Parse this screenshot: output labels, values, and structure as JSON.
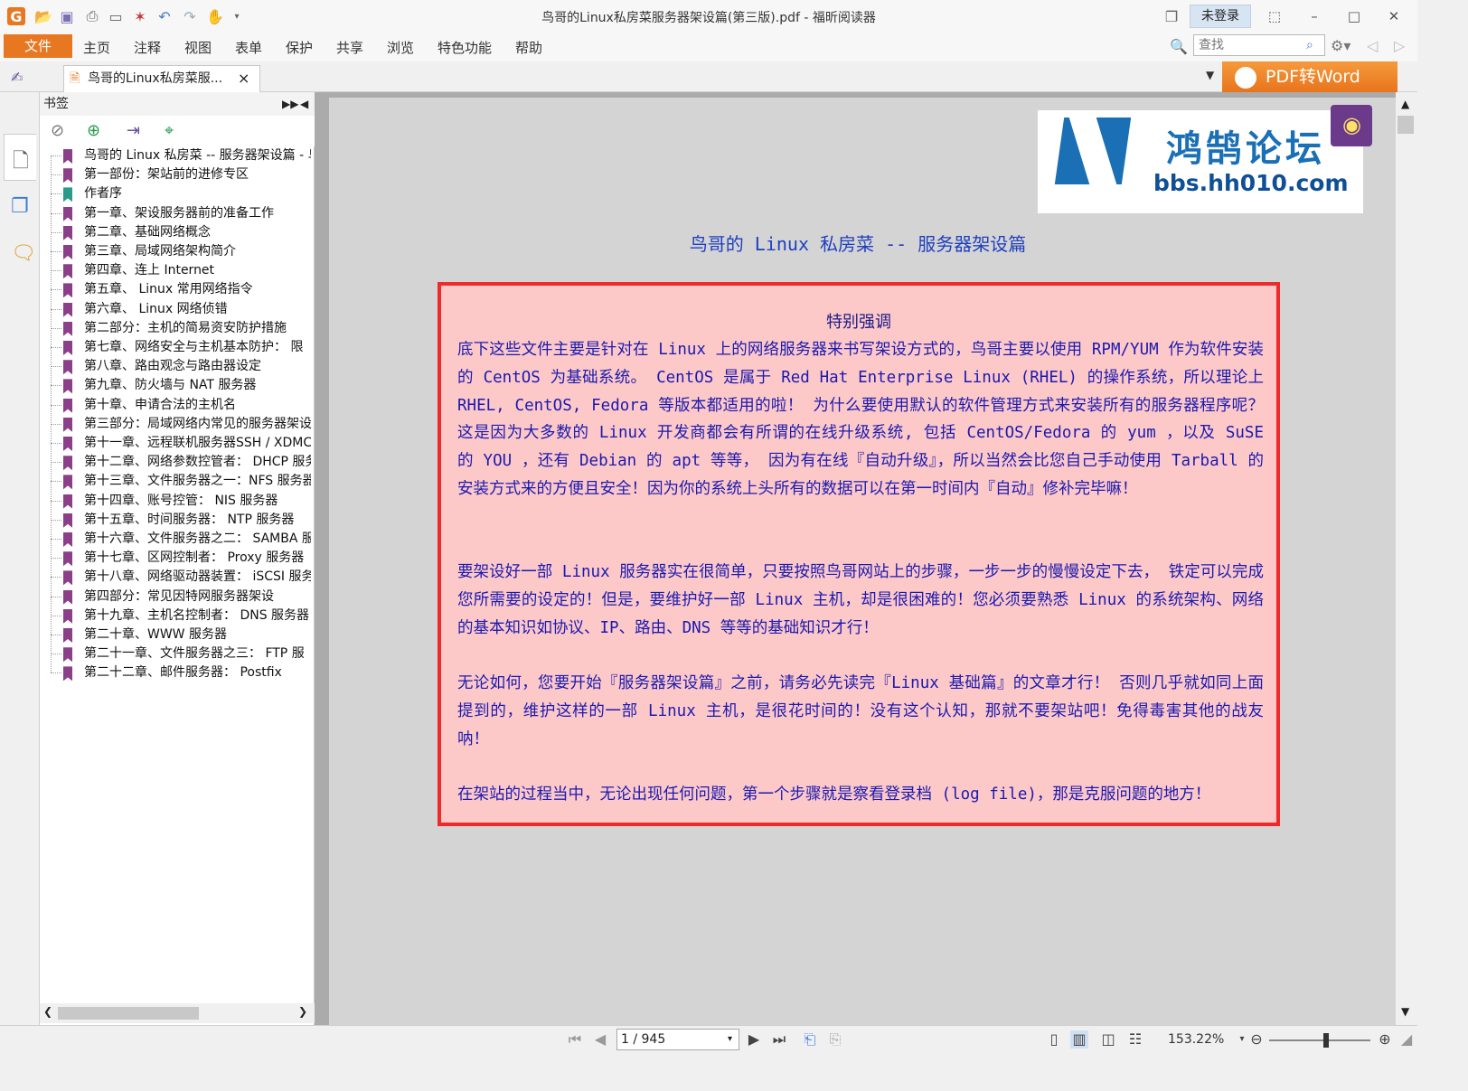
{
  "window": {
    "title": "鸟哥的Linux私房菜服务器架设篇(第三版).pdf - 福昕阅读器",
    "login_label": "未登录"
  },
  "menu": {
    "file": "文件",
    "items": [
      "主页",
      "注释",
      "视图",
      "表单",
      "保护",
      "共享",
      "浏览",
      "特色功能",
      "帮助"
    ],
    "search_placeholder": "查找"
  },
  "tab": {
    "label": "鸟哥的Linux私房菜服...",
    "close": "×",
    "promo": "PDF转Word"
  },
  "bookmarks": {
    "header": "书签",
    "items": [
      {
        "label": "鸟哥的 Linux 私房菜 -- 服务器架设篇 - 鸟",
        "color": "purple"
      },
      {
        "label": "第一部份：架站前的进修专区",
        "color": "purple"
      },
      {
        "label": "作者序",
        "color": "teal"
      },
      {
        "label": "第一章、架设服务器前的准备工作",
        "color": "purple"
      },
      {
        "label": "第二章、基础网络概念",
        "color": "purple"
      },
      {
        "label": "第三章、局域网络架构简介",
        "color": "purple"
      },
      {
        "label": "第四章、连上 Internet",
        "color": "purple"
      },
      {
        "label": "第五章、 Linux 常用网络指令",
        "color": "purple"
      },
      {
        "label": "第六章、 Linux 网络侦错",
        "color": "purple"
      },
      {
        "label": "第二部分：主机的简易资安防护措施",
        "color": "purple"
      },
      {
        "label": "第七章、网络安全与主机基本防护：  限",
        "color": "purple"
      },
      {
        "label": "第八章、路由观念与路由器设定",
        "color": "purple"
      },
      {
        "label": "第九章、防火墙与 NAT 服务器",
        "color": "purple"
      },
      {
        "label": "第十章、申请合法的主机名",
        "color": "purple"
      },
      {
        "label": "第三部分：局域网络内常见的服务器架设",
        "color": "purple"
      },
      {
        "label": "第十一章、远程联机服务器SSH / XDMCP",
        "color": "purple"
      },
      {
        "label": "第十二章、网络参数控管者：  DHCP 服务",
        "color": "purple"
      },
      {
        "label": "第十三章、文件服务器之一：NFS 服务器",
        "color": "purple"
      },
      {
        "label": "第十四章、账号控管：  NIS 服务器",
        "color": "purple"
      },
      {
        "label": "第十五章、时间服务器：  NTP 服务器",
        "color": "purple"
      },
      {
        "label": "第十六章、文件服务器之二：  SAMBA 服",
        "color": "purple"
      },
      {
        "label": "第十七章、区网控制者：  Proxy 服务器",
        "color": "purple"
      },
      {
        "label": "第十八章、网络驱动器装置：  iSCSI 服务",
        "color": "purple"
      },
      {
        "label": "第四部分：常见因特网服务器架设",
        "color": "purple"
      },
      {
        "label": "第十九章、主机名控制者：  DNS 服务器",
        "color": "purple"
      },
      {
        "label": "第二十章、WWW 服务器",
        "color": "purple"
      },
      {
        "label": "第二十一章、文件服务器之三：  FTP 服",
        "color": "purple"
      },
      {
        "label": "第二十二章、邮件服务器：  Postfix",
        "color": "purple"
      }
    ]
  },
  "document": {
    "logo_title": "鸿鹄论坛",
    "logo_url": "bbs.hh010.com",
    "page_title": "鸟哥的 Linux 私房菜 -- 服务器架设篇",
    "notice_title": "特别强调",
    "paragraphs": [
      "底下这些文件主要是针对在 Linux 上的网络服务器来书写架设方式的，鸟哥主要以使用 RPM/YUM 作为软件安装的 CentOS 为基础系统。 CentOS 是属于 Red Hat Enterprise Linux (RHEL) 的操作系统，所以理论上 RHEL, CentOS, Fedora 等版本都适用的啦！ 为什么要使用默认的软件管理方式来安装所有的服务器程序呢？这是因为大多数的 Linux 开发商都会有所谓的在线升级系统, 包括 CentOS/Fedora 的 yum ，以及 SuSE 的 YOU ，还有 Debian 的 apt 等等， 因为有在线『自动升级』，所以当然会比您自己手动使用 Tarball 的安装方式来的方便且安全！因为你的系统上头所有的数据可以在第一时间内『自动』修补完毕嘛！",
      "要架设好一部 Linux 服务器实在很简单，只要按照鸟哥网站上的步骤，一步一步的慢慢设定下去， 铁定可以完成您所需要的设定的！但是，要维护好一部 Linux 主机，却是很困难的！您必须要熟悉 Linux 的系统架构、网络的基本知识如协议、IP、路由、DNS 等等的基础知识才行！",
      "无论如何，您要开始『服务器架设篇』之前，请务必先读完『Linux 基础篇』的文章才行！ 否则几乎就如同上面提到的，维护这样的一部 Linux 主机，是很花时间的！没有这个认知，那就不要架站吧！免得毒害其他的战友呐！",
      "在架站的过程当中，无论出现任何问题，第一个步骤就是察看登录档 (log file)，那是克服问题的地方！"
    ]
  },
  "status": {
    "page_indicator": "1 / 945",
    "zoom": "153.22%"
  },
  "colors": {
    "accent_orange": "#e87722",
    "notice_border": "#ee2a2a",
    "notice_bg": "#fdc8c8",
    "doc_text": "#1a1ab0",
    "bookmark_purple": "#8b3f88",
    "bookmark_teal": "#2a9a8d"
  }
}
